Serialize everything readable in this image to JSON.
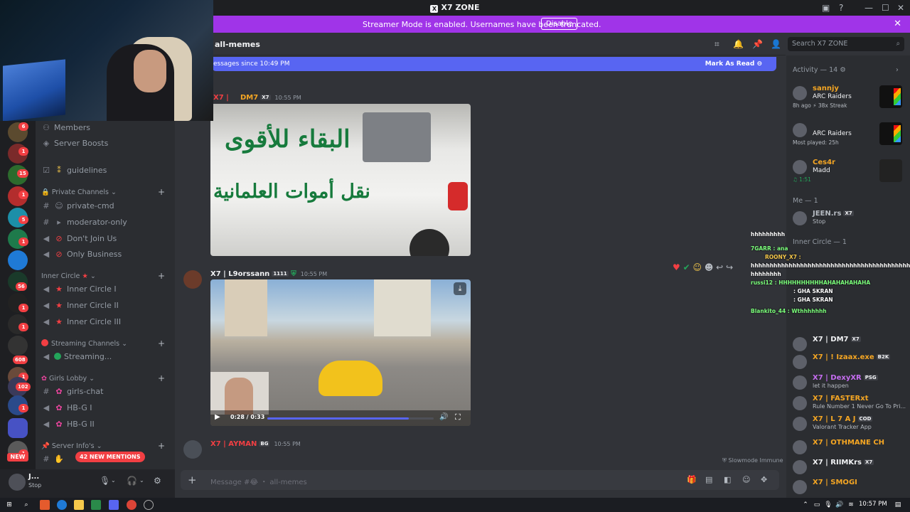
{
  "window": {
    "title": "X7 ZONE"
  },
  "banner": {
    "text": "Streamer Mode is enabled. Usernames have been truncated.",
    "button": "Disable"
  },
  "header": {
    "channel": "all-memes",
    "search_placeholder": "Search X7 ZONE"
  },
  "new_messages": {
    "text": "essages since 10:49 PM",
    "mark_read": "Mark As Read"
  },
  "server_rail": {
    "badges": [
      "6",
      "1",
      "15",
      "1",
      "5",
      "1",
      "56",
      "1",
      "1",
      "608",
      "1",
      "102",
      "1",
      "1"
    ],
    "new_label": "NEW"
  },
  "channels": {
    "top": [
      {
        "icon": "members-icon",
        "label": "Members"
      },
      {
        "icon": "boost-icon",
        "label": "Server Boosts"
      },
      {
        "icon": "rules-icon",
        "label": "guidelines"
      }
    ],
    "private": {
      "label": "Private Channels",
      "items": [
        "private-cmd",
        "moderator-only",
        "Don't Join Us",
        "Only Business"
      ]
    },
    "inner": {
      "label": "Inner Circle",
      "items": [
        "Inner Circle I",
        "Inner Circle II",
        "Inner Circle III"
      ]
    },
    "streaming": {
      "label": "Streaming Channels",
      "items": [
        "Streaming..."
      ]
    },
    "girls": {
      "label": "Girls Lobby",
      "items": [
        "girls-chat",
        "HB-G I",
        "HB-G II"
      ]
    },
    "server_info": {
      "label": "Server Info's",
      "mentions": "42 NEW MENTIONS"
    }
  },
  "user_panel": {
    "name": "J...",
    "status": "Stop"
  },
  "messages": [
    {
      "author": "DM7",
      "tag": "X7",
      "prefix": "X7 |",
      "time": "10:55 PM",
      "caption": "البقاء للأقوى",
      "caption2": "نقل أموات العلمانية"
    },
    {
      "author": "X7 | L9orssann",
      "tag": "1111",
      "time": "10:55 PM",
      "video_time": "0:28 / 0:33",
      "progress": 0.85
    },
    {
      "author": "X7 | AYMAN",
      "tag": "BG",
      "time": "10:55 PM"
    }
  ],
  "slowmode": "Slowmode Immune",
  "composer": {
    "placeholder": "Message #😂 ・ all-memes"
  },
  "member_panel": {
    "activity_header": "Activity — 14",
    "activities": [
      {
        "name": "sannjy",
        "game": "ARC Raiders",
        "detail": "8h ago  ⚡ 38x Streak"
      },
      {
        "name": "",
        "game": "ARC Raiders",
        "detail": "Most played: 25h"
      },
      {
        "name": "Ces4r",
        "game": "Madd",
        "detail": "♫ 1:51"
      }
    ],
    "me_header": "Me — 1",
    "me": {
      "name": "JEEN.rs",
      "tag": "X7",
      "status": "Stop"
    },
    "inner_header": "Inner Circle — 1",
    "list": [
      {
        "name": "X7 | DM7",
        "tag": "X7",
        "status": "",
        "color": "#f2f3f5"
      },
      {
        "name": "X7 | ! Izaax.exe",
        "tag": "B2K",
        "status": "",
        "color": "#f5a623"
      },
      {
        "name": "X7 | DexyXR",
        "tag": "PSG",
        "status": "let it happen",
        "color": "#c56df0"
      },
      {
        "name": "X7 | FASTERxt",
        "tag": "",
        "status": "Rule Number 1 Never Go To Pri...",
        "color": "#f5a623"
      },
      {
        "name": "X7 | L 7 A J",
        "tag": "COD",
        "status": "Valorant Tracker App",
        "color": "#f5a623"
      },
      {
        "name": "X7 | OTHMANE CH",
        "tag": "",
        "status": "",
        "color": "#f5a623"
      },
      {
        "name": "X7 | RIIMKrs",
        "tag": "X7",
        "status": "",
        "color": "#f2f3f5"
      },
      {
        "name": "X7 | SMOGI",
        "tag": "",
        "status": "",
        "color": "#f5a623"
      }
    ]
  },
  "stream_overlay": [
    "hhhhhhhhh",
    "7GARR : ana",
    "ROONY_X7 :",
    "hhhhhhhhhhhhhhhhhhhhhhhhhhhhhhhhhhhhhhhhhh",
    "hhhhhhhh",
    "russi12 : HHHHHHHHHHAHAHAHAHAHA",
    ": GHA SKRAN",
    ": GHA SKRAN",
    "Blankito_44 : Wthhhhhhh"
  ],
  "taskbar": {
    "time": "10:57 PM"
  }
}
